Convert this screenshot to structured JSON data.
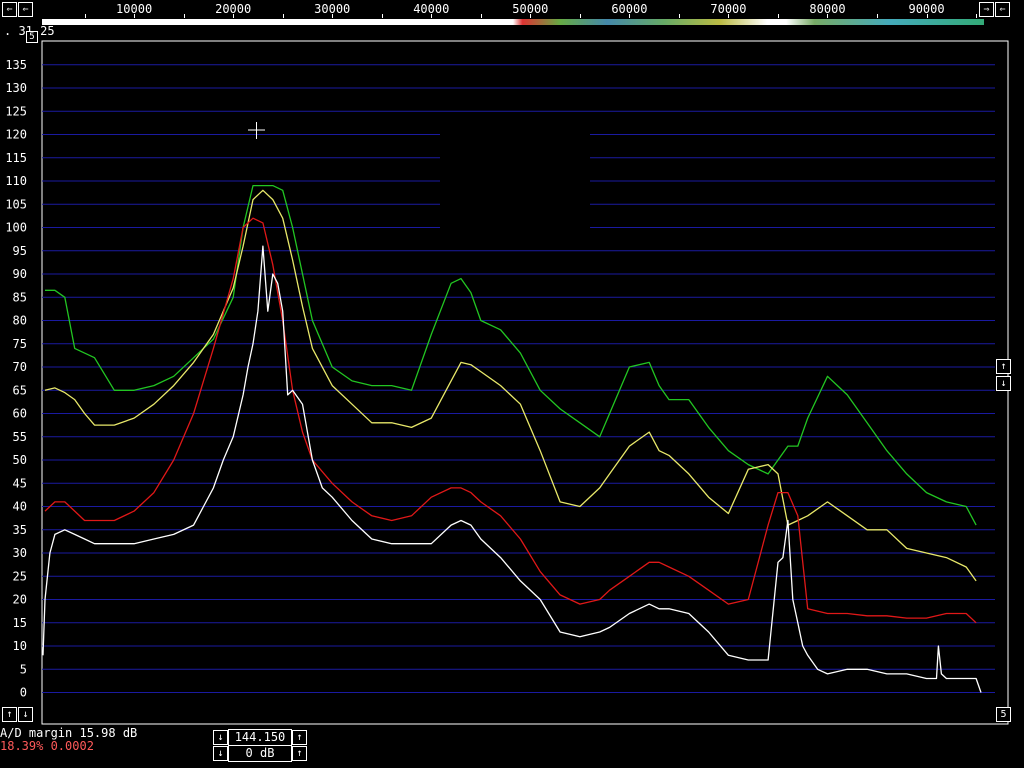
{
  "top_bar": {
    "left_arrow_1": "⇐",
    "left_arrow_2": "⇐",
    "right_arrow_1": "⇒",
    "right_arrow_2": "⇐",
    "freq_labels": [
      "10000",
      "20000",
      "30000",
      "40000",
      "50000",
      "60000",
      "70000",
      "80000",
      "90000"
    ],
    "corner_readout": ". 31.25"
  },
  "left_panel": {
    "small_button": "5",
    "up_button": "↑",
    "down_button": "↓"
  },
  "right_panel": {
    "up_button": "↑",
    "down_button": "↓",
    "bottom_button": "5"
  },
  "status": {
    "ad_margin": "A/D margin 15.98 dB",
    "percent": "18.39% 0.0002"
  },
  "controls": {
    "freq_down": "↓",
    "freq_value": "144.150",
    "freq_up": "↑",
    "gain_down": "↓",
    "gain_value": "0 dB",
    "gain_up": "↑"
  },
  "colors": {
    "background": "#000000",
    "grid": "#1a1aa0",
    "green": "#22c522",
    "yellow": "#e8e86a",
    "red": "#e01818",
    "white": "#ffffff",
    "status_red": "#ff5a5a"
  },
  "chart_data": {
    "type": "line",
    "y_ticks": [
      0,
      5,
      10,
      15,
      20,
      25,
      30,
      35,
      40,
      45,
      50,
      55,
      60,
      65,
      70,
      75,
      80,
      85,
      90,
      95,
      100,
      105,
      110,
      115,
      120,
      125,
      130,
      135
    ],
    "x_ticks": [
      10000,
      20000,
      30000,
      40000,
      50000,
      60000,
      70000,
      80000,
      90000
    ],
    "xlim": [
      700,
      95800
    ],
    "ylim": [
      0,
      135
    ],
    "series": [
      {
        "color": "green",
        "x": [
          1000,
          2000,
          3000,
          4000,
          5000,
          6000,
          8000,
          10000,
          12000,
          14000,
          16000,
          18000,
          20000,
          21000,
          22000,
          23000,
          24000,
          25000,
          26000,
          27000,
          28000,
          30000,
          32000,
          34000,
          36000,
          38000,
          40000,
          42000,
          43000,
          44000,
          45000,
          47000,
          49000,
          51000,
          53000,
          55000,
          57000,
          58000,
          60000,
          62000,
          63000,
          64000,
          66000,
          68000,
          70000,
          72000,
          74000,
          75000,
          76000,
          77000,
          78000,
          80000,
          82000,
          84000,
          86000,
          88000,
          90000,
          92000,
          94000,
          95000
        ],
        "values": [
          86.5,
          86.5,
          85,
          74,
          73,
          72,
          65,
          65,
          66,
          68,
          72,
          76,
          85,
          100,
          109,
          109,
          109,
          108,
          100,
          90,
          80,
          70,
          67,
          66,
          66,
          65,
          77,
          88,
          89,
          86,
          80,
          78,
          73,
          65,
          61,
          58,
          55,
          60,
          70,
          71,
          66,
          63,
          63,
          57,
          52,
          49,
          47,
          50,
          53,
          53,
          59,
          68,
          64,
          58,
          52,
          47,
          43,
          41,
          40,
          36
        ]
      },
      {
        "color": "yellow",
        "x": [
          1000,
          2000,
          3000,
          4000,
          5000,
          6000,
          8000,
          10000,
          12000,
          14000,
          16000,
          18000,
          20000,
          21000,
          22000,
          23000,
          24000,
          25000,
          26000,
          27000,
          28000,
          30000,
          32000,
          34000,
          36000,
          38000,
          40000,
          42000,
          43000,
          44000,
          45000,
          47000,
          49000,
          51000,
          53000,
          55000,
          57000,
          58000,
          60000,
          62000,
          63000,
          64000,
          66000,
          68000,
          70000,
          72000,
          74000,
          75000,
          76000,
          77000,
          78000,
          80000,
          82000,
          84000,
          86000,
          88000,
          90000,
          92000,
          94000,
          95000
        ],
        "values": [
          65,
          65.5,
          64.5,
          63,
          60,
          57.5,
          57.5,
          59,
          62,
          66,
          71,
          77,
          87,
          96,
          106,
          108,
          106,
          102,
          93,
          83,
          74,
          66,
          62,
          58,
          58,
          57,
          59,
          67,
          71,
          70.5,
          69,
          66,
          62,
          52,
          41,
          40,
          44,
          47,
          53,
          56,
          52,
          51,
          47,
          42,
          38.5,
          48,
          49,
          47,
          36,
          37,
          38,
          41,
          38,
          35,
          35,
          31,
          30,
          29,
          27,
          24
        ]
      },
      {
        "color": "red",
        "x": [
          1000,
          2000,
          3000,
          4000,
          5000,
          6000,
          8000,
          10000,
          12000,
          14000,
          16000,
          18000,
          20000,
          21000,
          22000,
          23000,
          24000,
          25000,
          26000,
          27000,
          28000,
          30000,
          32000,
          34000,
          36000,
          38000,
          40000,
          42000,
          43000,
          44000,
          45000,
          47000,
          49000,
          51000,
          53000,
          55000,
          57000,
          58000,
          60000,
          62000,
          63000,
          64000,
          66000,
          68000,
          70000,
          72000,
          74000,
          75000,
          76000,
          77000,
          78000,
          80000,
          82000,
          84000,
          86000,
          88000,
          90000,
          92000,
          94000,
          95000
        ],
        "values": [
          39,
          41,
          41,
          39,
          37,
          37,
          37,
          39,
          43,
          50,
          60,
          74,
          89,
          100,
          102,
          101,
          92,
          80,
          65,
          56,
          50,
          45,
          41,
          38,
          37,
          38,
          42,
          44,
          44,
          43,
          41,
          38,
          33,
          26,
          21,
          19,
          20,
          22,
          25,
          28,
          28,
          27,
          25,
          22,
          19,
          20,
          36,
          43,
          43,
          38,
          18,
          17,
          17,
          16.5,
          16.5,
          16,
          16,
          17,
          17,
          15
        ]
      },
      {
        "color": "white",
        "x": [
          800,
          1000,
          1500,
          2000,
          3000,
          4000,
          5000,
          6000,
          8000,
          10000,
          12000,
          14000,
          16000,
          17000,
          18000,
          19000,
          20000,
          21000,
          21500,
          22000,
          22500,
          23000,
          23500,
          24000,
          24500,
          25000,
          25500,
          26000,
          27000,
          28000,
          29000,
          30000,
          32000,
          34000,
          36000,
          38000,
          40000,
          42000,
          43000,
          44000,
          45000,
          47000,
          49000,
          51000,
          53000,
          55000,
          57000,
          58000,
          60000,
          62000,
          63000,
          64000,
          66000,
          68000,
          70000,
          72000,
          73000,
          74000,
          75000,
          75500,
          76000,
          76500,
          77000,
          77500,
          78000,
          79000,
          80000,
          82000,
          84000,
          86000,
          88000,
          90000,
          91000,
          91200,
          91500,
          92000,
          94000,
          95000,
          95500
        ],
        "values": [
          8,
          20,
          30,
          34,
          35,
          34,
          33,
          32,
          32,
          32,
          33,
          34,
          36,
          40,
          44,
          50,
          55,
          64,
          70,
          75,
          82,
          96,
          82,
          90,
          88,
          82,
          64,
          65,
          62,
          50,
          44,
          42,
          37,
          33,
          32,
          32,
          32,
          36,
          37,
          36,
          33,
          29,
          24,
          20,
          13,
          12,
          13,
          14,
          17,
          19,
          18,
          18,
          17,
          13,
          8,
          7,
          7,
          7,
          28,
          29,
          37,
          20,
          15,
          10,
          8,
          5,
          4,
          5,
          5,
          4,
          4,
          3,
          3,
          10,
          4,
          3,
          3,
          3,
          0
        ]
      }
    ]
  }
}
